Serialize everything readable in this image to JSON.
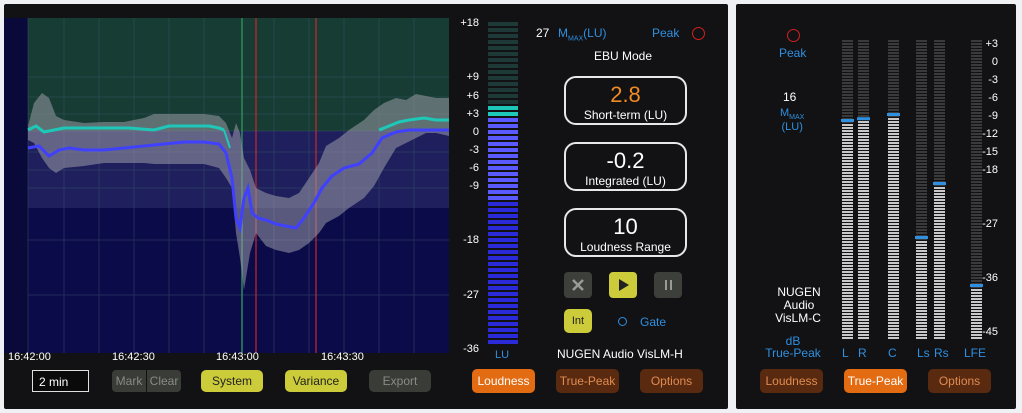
{
  "left": {
    "time_labels": [
      "16:42:00",
      "16:42:30",
      "16:43:00",
      "16:43:30"
    ],
    "lu_scale": [
      "+18",
      "+9",
      "+6",
      "+3",
      "0",
      "-3",
      "-6",
      "-9",
      "-18",
      "-27",
      "-36"
    ],
    "lu_label": "LU",
    "mmax_value": "27",
    "mmax_label_prefix": "M",
    "mmax_label_sub": "MAX",
    "mmax_label_suffix": "(LU)",
    "peak_label": "Peak",
    "mode_label": "EBU Mode",
    "short_term": {
      "value": "2.8",
      "label": "Short-term (LU)"
    },
    "integrated": {
      "value": "-0.2",
      "label": "Integrated (LU)"
    },
    "loudness_range": {
      "value": "10",
      "label": "Loudness Range"
    },
    "int_label": "Int",
    "gate_label": "Gate",
    "brand": "NUGEN Audio VisLM-H",
    "time_window": "2 min",
    "mark_label": "Mark",
    "clear_label": "Clear",
    "system_label": "System",
    "variance_label": "Variance",
    "export_label": "Export",
    "tabs": [
      "Loudness",
      "True-Peak",
      "Options"
    ],
    "active_tab": "Loudness"
  },
  "right": {
    "peak_label": "Peak",
    "mmax_value": "16",
    "mmax_label_prefix": "M",
    "mmax_label_sub": "MAX",
    "mmax_label_suffix": "(LU)",
    "brand_line1": "NUGEN",
    "brand_line2": "Audio",
    "brand_line3": "VisLM-C",
    "unit_line1": "dB",
    "unit_line2": "True-Peak",
    "scale": [
      "+3",
      "0",
      "-3",
      "-6",
      "-9",
      "-12",
      "-15",
      "-18",
      "-27",
      "-36",
      "-45"
    ],
    "channels": [
      "L",
      "R",
      "C",
      "Ls",
      "Rs",
      "LFE"
    ],
    "channel_levels_db": [
      -9.5,
      -9.2,
      -8.5,
      -29.0,
      -20.0,
      -37.0
    ],
    "tabs": [
      "Loudness",
      "True-Peak",
      "Options"
    ],
    "active_tab": "True-Peak"
  },
  "colors": {
    "accent_orange": "#e36b12",
    "short_term_value": "#f08a24",
    "cyan_trace": "#1ec8b8",
    "blue_trace": "#4040ff",
    "label_blue": "#2f8fe0",
    "peak_ring": "#d02020"
  }
}
